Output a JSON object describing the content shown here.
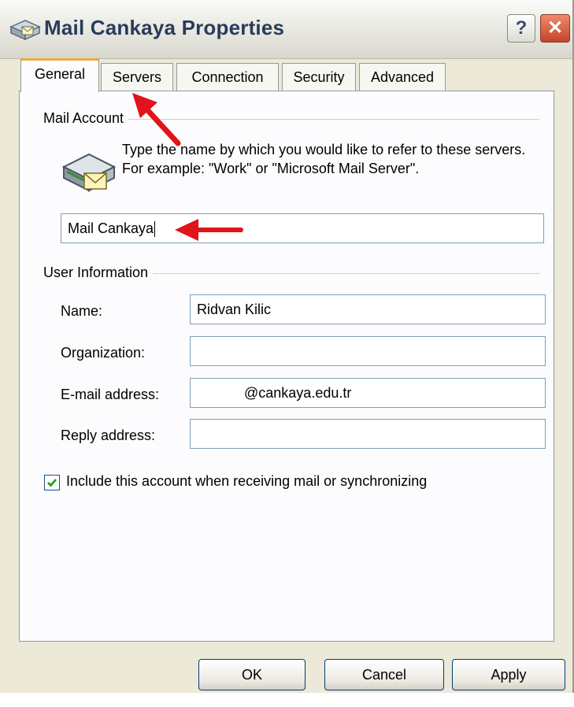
{
  "window": {
    "title": "Mail Cankaya Properties",
    "help_glyph": "?",
    "close_glyph": "✕"
  },
  "tabs": [
    {
      "label": "General",
      "active": true
    },
    {
      "label": "Servers",
      "active": false
    },
    {
      "label": "Connection",
      "active": false
    },
    {
      "label": "Security",
      "active": false
    },
    {
      "label": "Advanced",
      "active": false
    }
  ],
  "mail_account": {
    "group_label": "Mail Account",
    "description": "Type the name by which you would like to refer to these servers.  For example: \"Work\" or \"Microsoft Mail Server\".",
    "account_name": "Mail Cankaya",
    "icon": "mail-server-icon"
  },
  "user_information": {
    "group_label": "User Information",
    "fields": [
      {
        "label": "Name:",
        "value": "Ridvan Kilic"
      },
      {
        "label": "Organization:",
        "value": ""
      },
      {
        "label": "E-mail address:",
        "value": "@cankaya.edu.tr"
      },
      {
        "label": "Reply address:",
        "value": ""
      }
    ]
  },
  "include_account": {
    "label": "Include this account when receiving mail or synchronizing",
    "checked": true
  },
  "buttons": {
    "ok": "OK",
    "cancel": "Cancel",
    "apply": "Apply"
  },
  "colors": {
    "annotation_arrow": "#e0141a",
    "active_tab_accent": "#f2a93a"
  }
}
